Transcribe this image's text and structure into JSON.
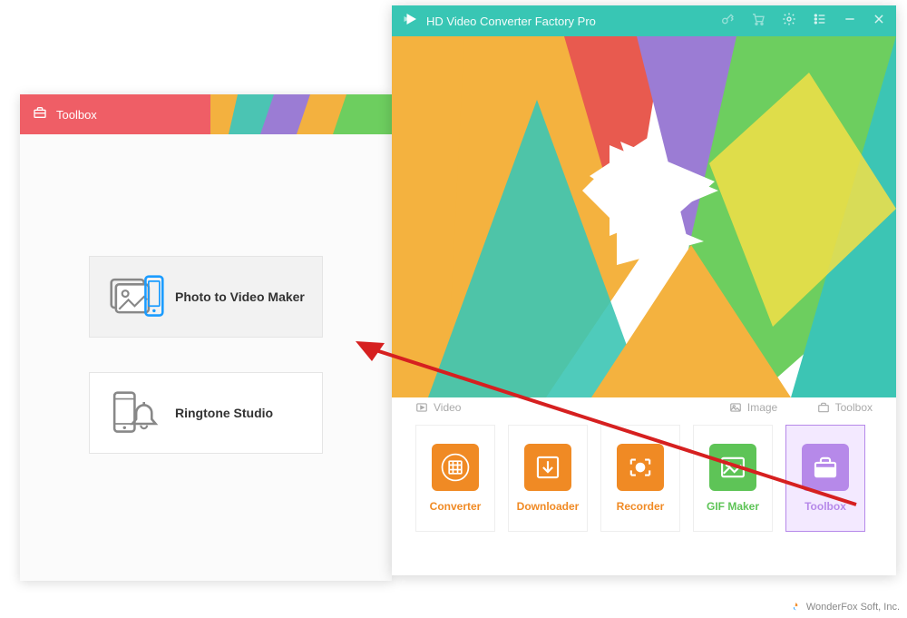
{
  "toolbox": {
    "title": "Toolbox",
    "items": [
      {
        "label": "Photo to Video Maker"
      },
      {
        "label": "Ringtone Studio"
      }
    ]
  },
  "main": {
    "title": "HD Video Converter Factory Pro",
    "categories": {
      "video": "Video",
      "image": "Image",
      "toolbox": "Toolbox"
    },
    "tiles": [
      {
        "label": "Converter"
      },
      {
        "label": "Downloader"
      },
      {
        "label": "Recorder"
      },
      {
        "label": "GIF Maker"
      },
      {
        "label": "Toolbox"
      }
    ]
  },
  "watermark": "WonderFox Soft, Inc."
}
